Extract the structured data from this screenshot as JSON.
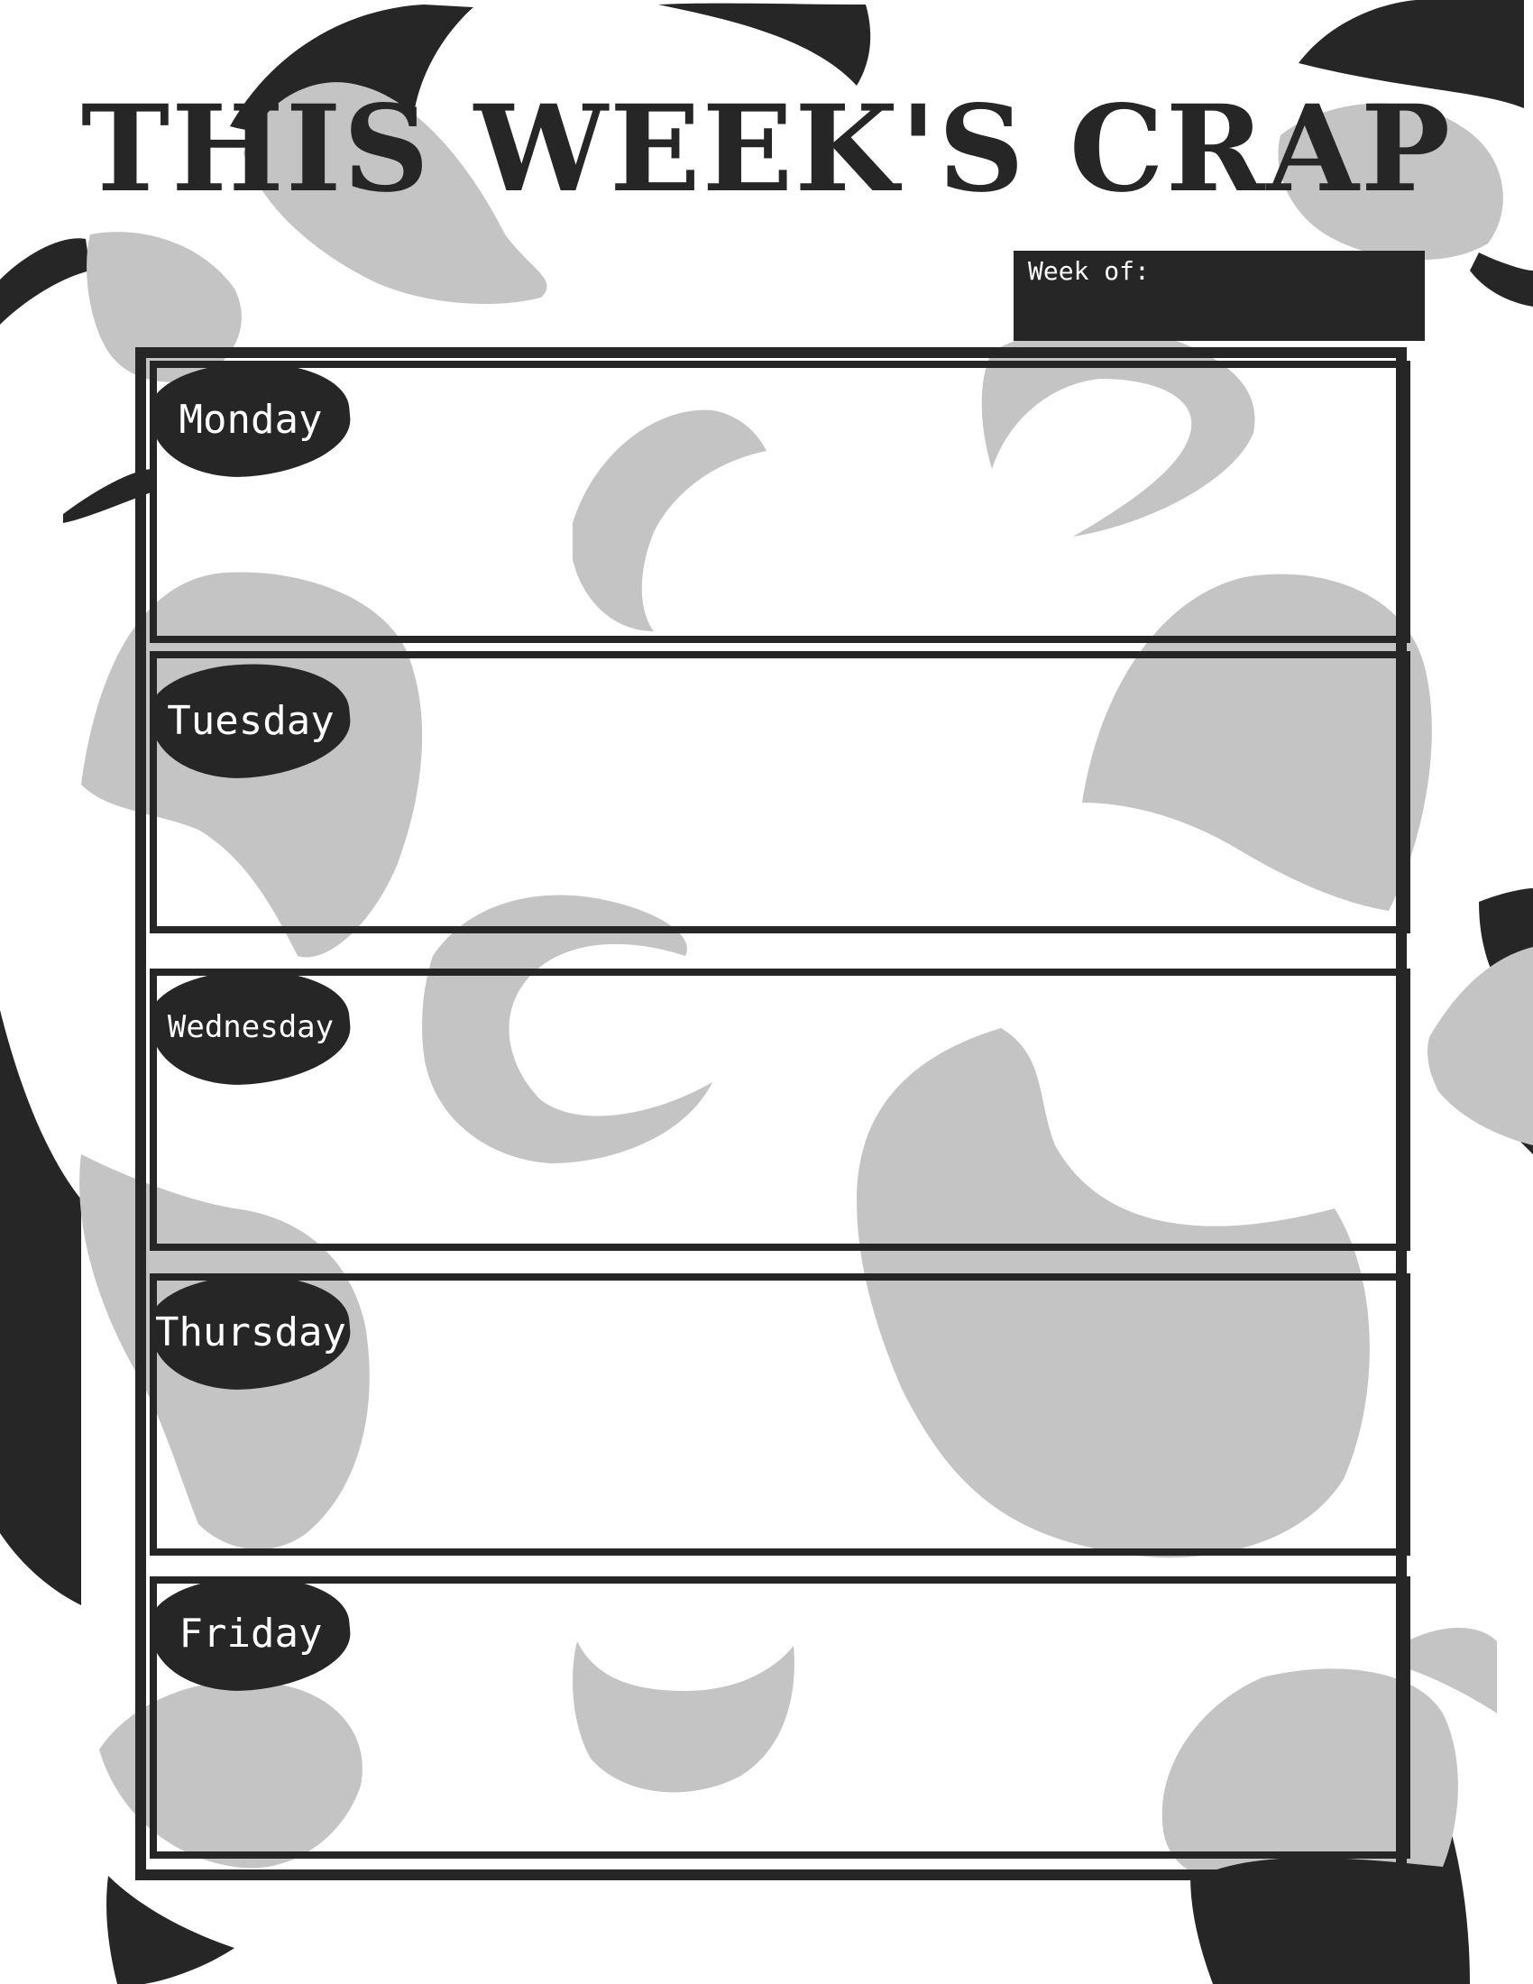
{
  "header": {
    "title": "THIS WEEK'S CRAP",
    "week_of_label": "Week of:"
  },
  "days": [
    {
      "label": "Monday"
    },
    {
      "label": "Tuesday"
    },
    {
      "label": "Wednesday"
    },
    {
      "label": "Thursday"
    },
    {
      "label": "Friday"
    }
  ],
  "colors": {
    "dark": "#262626",
    "gray_blob": "#c4c4c4",
    "background": "#ffffff"
  }
}
